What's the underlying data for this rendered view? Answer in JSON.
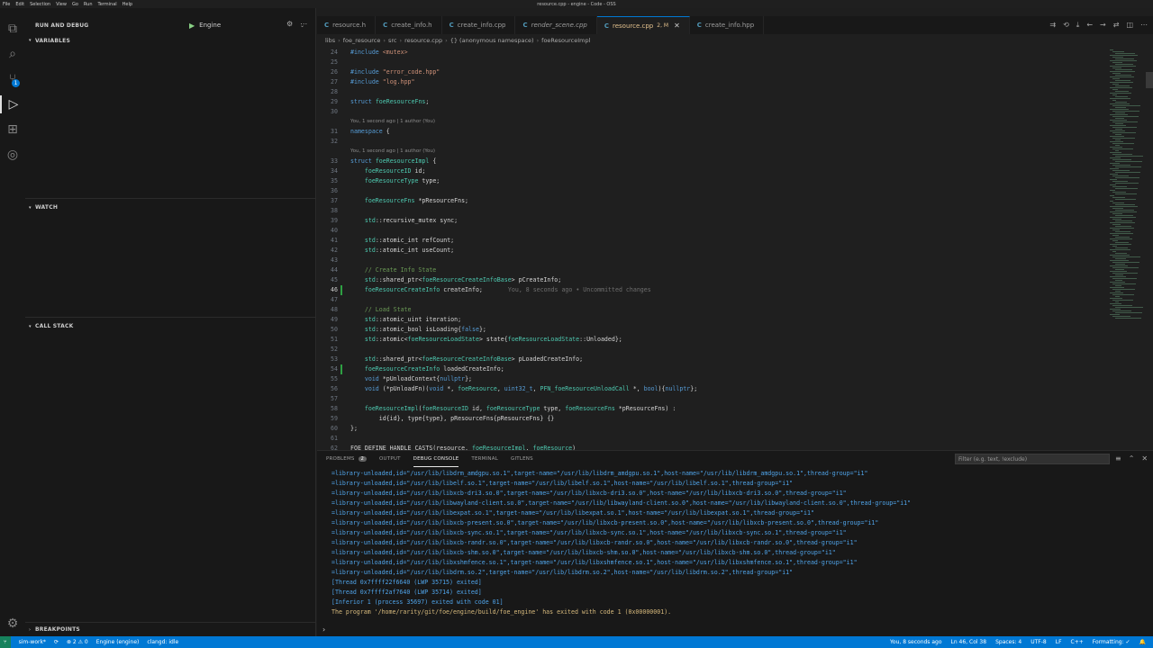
{
  "window": {
    "title": "resource.cpp - engine - Code - OSS",
    "menu": [
      "File",
      "Edit",
      "Selection",
      "View",
      "Go",
      "Run",
      "Terminal",
      "Help"
    ]
  },
  "activity_bar": {
    "items": [
      {
        "name": "explorer-icon",
        "glyph": "⧉"
      },
      {
        "name": "search-icon",
        "glyph": "⌕"
      },
      {
        "name": "source-control-icon",
        "glyph": "⑂",
        "badge": "1"
      },
      {
        "name": "run-debug-icon",
        "glyph": "▷"
      },
      {
        "name": "extensions-icon",
        "glyph": "⊞"
      },
      {
        "name": "remote-icon",
        "glyph": "◎"
      }
    ],
    "settings_glyph": "⚙"
  },
  "sidebar": {
    "title": "RUN AND DEBUG",
    "config": "Engine",
    "sections": {
      "variables": "VARIABLES",
      "watch": "WATCH",
      "call_stack": "CALL STACK",
      "breakpoints": "BREAKPOINTS"
    }
  },
  "tabs": [
    {
      "label": "resource.h",
      "icon": "C",
      "italic": false,
      "active": false
    },
    {
      "label": "create_info.h",
      "icon": "C",
      "italic": false,
      "active": false
    },
    {
      "label": "create_info.cpp",
      "icon": "C",
      "italic": false,
      "active": false
    },
    {
      "label": "render_scene.cpp",
      "icon": "C",
      "italic": true,
      "active": false
    },
    {
      "label": "resource.cpp",
      "icon": "C",
      "italic": false,
      "active": true,
      "modified": "2, M"
    },
    {
      "label": "create_info.hpp",
      "icon": "C",
      "italic": false,
      "active": false
    }
  ],
  "breadcrumb": [
    "libs",
    "foe_resource",
    "src",
    "resource.cpp",
    "{} (anonymous namespace)",
    "foeResourceImpl"
  ],
  "code": {
    "lines": [
      {
        "n": "24",
        "t": "#include <mutex>"
      },
      {
        "n": "25",
        "t": ""
      },
      {
        "n": "26",
        "t": "#include \"error_code.hpp\""
      },
      {
        "n": "27",
        "t": "#include \"log.hpp\""
      },
      {
        "n": "28",
        "t": ""
      },
      {
        "n": "29",
        "t": "struct foeResourceFns;"
      },
      {
        "n": "30",
        "t": ""
      },
      {
        "n": "31",
        "t": "namespace {",
        "lens": "You, 1 second ago | 1 author (You)"
      },
      {
        "n": "32",
        "t": ""
      },
      {
        "n": "33",
        "t": "struct foeResourceImpl {",
        "lens": "You, 1 second ago | 1 author (You)"
      },
      {
        "n": "34",
        "t": "    foeResourceID id;"
      },
      {
        "n": "35",
        "t": "    foeResourceType type;"
      },
      {
        "n": "36",
        "t": ""
      },
      {
        "n": "37",
        "t": "    foeResourceFns *pResourceFns;"
      },
      {
        "n": "38",
        "t": ""
      },
      {
        "n": "39",
        "t": "    std::recursive_mutex sync;"
      },
      {
        "n": "40",
        "t": ""
      },
      {
        "n": "41",
        "t": "    std::atomic_int refCount;"
      },
      {
        "n": "42",
        "t": "    std::atomic_int useCount;"
      },
      {
        "n": "43",
        "t": ""
      },
      {
        "n": "44",
        "t": "    // Create Info State"
      },
      {
        "n": "45",
        "t": "    std::shared_ptr<foeResourceCreateInfoBase> pCreateInfo;"
      },
      {
        "n": "46",
        "t": "    foeResourceCreateInfo createInfo;",
        "blame": "You, 8 seconds ago • Uncommitted changes",
        "current": true,
        "changed": true
      },
      {
        "n": "47",
        "t": ""
      },
      {
        "n": "48",
        "t": "    // Load State"
      },
      {
        "n": "49",
        "t": "    std::atomic_uint iteration;"
      },
      {
        "n": "50",
        "t": "    std::atomic_bool isLoading{false};"
      },
      {
        "n": "51",
        "t": "    std::atomic<foeResourceLoadState> state{foeResourceLoadState::Unloaded};"
      },
      {
        "n": "52",
        "t": ""
      },
      {
        "n": "53",
        "t": "    std::shared_ptr<foeResourceCreateInfoBase> pLoadedCreateInfo;"
      },
      {
        "n": "54",
        "t": "    foeResourceCreateInfo loadedCreateInfo;",
        "changed": true
      },
      {
        "n": "55",
        "t": "    void *pUnloadContext{nullptr};"
      },
      {
        "n": "56",
        "t": "    void (*pUnloadFn)(void *, foeResource, uint32_t, PFN_foeResourceUnloadCall *, bool){nullptr};"
      },
      {
        "n": "57",
        "t": ""
      },
      {
        "n": "58",
        "t": "    foeResourceImpl(foeResourceID id, foeResourceType type, foeResourceFns *pResourceFns) :"
      },
      {
        "n": "59",
        "t": "        id{id}, type{type}, pResourceFns{pResourceFns} {}"
      },
      {
        "n": "60",
        "t": "};"
      },
      {
        "n": "61",
        "t": ""
      },
      {
        "n": "62",
        "t": "FOE_DEFINE_HANDLE_CASTS(resource, foeResourceImpl, foeResource)"
      }
    ]
  },
  "panel": {
    "tabs": [
      {
        "label": "PROBLEMS",
        "badge": "2",
        "active": false
      },
      {
        "label": "OUTPUT",
        "active": false
      },
      {
        "label": "DEBUG CONSOLE",
        "active": true
      },
      {
        "label": "TERMINAL",
        "active": false
      },
      {
        "label": "GITLENS",
        "active": false
      }
    ],
    "filter_placeholder": "Filter (e.g. text, !exclude)",
    "console": [
      "=library-unloaded,id=\"/usr/lib/libdrm_amdgpu.so.1\",target-name=\"/usr/lib/libdrm_amdgpu.so.1\",host-name=\"/usr/lib/libdrm_amdgpu.so.1\",thread-group=\"i1\"",
      "=library-unloaded,id=\"/usr/lib/libelf.so.1\",target-name=\"/usr/lib/libelf.so.1\",host-name=\"/usr/lib/libelf.so.1\",thread-group=\"i1\"",
      "=library-unloaded,id=\"/usr/lib/libxcb-dri3.so.0\",target-name=\"/usr/lib/libxcb-dri3.so.0\",host-name=\"/usr/lib/libxcb-dri3.so.0\",thread-group=\"i1\"",
      "=library-unloaded,id=\"/usr/lib/libwayland-client.so.0\",target-name=\"/usr/lib/libwayland-client.so.0\",host-name=\"/usr/lib/libwayland-client.so.0\",thread-group=\"i1\"",
      "=library-unloaded,id=\"/usr/lib/libexpat.so.1\",target-name=\"/usr/lib/libexpat.so.1\",host-name=\"/usr/lib/libexpat.so.1\",thread-group=\"i1\"",
      "=library-unloaded,id=\"/usr/lib/libxcb-present.so.0\",target-name=\"/usr/lib/libxcb-present.so.0\",host-name=\"/usr/lib/libxcb-present.so.0\",thread-group=\"i1\"",
      "=library-unloaded,id=\"/usr/lib/libxcb-sync.so.1\",target-name=\"/usr/lib/libxcb-sync.so.1\",host-name=\"/usr/lib/libxcb-sync.so.1\",thread-group=\"i1\"",
      "=library-unloaded,id=\"/usr/lib/libxcb-randr.so.0\",target-name=\"/usr/lib/libxcb-randr.so.0\",host-name=\"/usr/lib/libxcb-randr.so.0\",thread-group=\"i1\"",
      "=library-unloaded,id=\"/usr/lib/libxcb-shm.so.0\",target-name=\"/usr/lib/libxcb-shm.so.0\",host-name=\"/usr/lib/libxcb-shm.so.0\",thread-group=\"i1\"",
      "=library-unloaded,id=\"/usr/lib/libxshmfence.so.1\",target-name=\"/usr/lib/libxshmfence.so.1\",host-name=\"/usr/lib/libxshmfence.so.1\",thread-group=\"i1\"",
      "=library-unloaded,id=\"/usr/lib/libdrm.so.2\",target-name=\"/usr/lib/libdrm.so.2\",host-name=\"/usr/lib/libdrm.so.2\",thread-group=\"i1\"",
      "[Thread 0x7ffff22f6640 (LWP 35715) exited]",
      "[Thread 0x7ffff2af7640 (LWP 35714) exited]",
      "[Inferior 1 (process 35697) exited with code 01]"
    ],
    "exit_message": "The program '/home/rarity/git/foe/engine/build/foe_engine' has exited with code 1 (0x00000001).",
    "repl_prompt": "›"
  },
  "status": {
    "remote": "⑂",
    "branch": "sim-work*",
    "sync": "⟳",
    "problems": "⊗ 2 ⚠ 0",
    "debug_target": "Engine (engine)",
    "clangd": "clangd: idle",
    "blame": "You, 8 seconds ago",
    "position": "Ln 46, Col 38",
    "spaces": "Spaces: 4",
    "encoding": "UTF-8",
    "eol": "LF",
    "language": "C++",
    "formatting": "Formatting: ✓"
  },
  "colors": {
    "accent": "#0078d4",
    "editor_bg": "#1f1f1f",
    "sidebar_bg": "#181818",
    "status_bg": "#0078d4",
    "console_text": "#4fa3e8",
    "exit_text": "#d7ba7d"
  }
}
